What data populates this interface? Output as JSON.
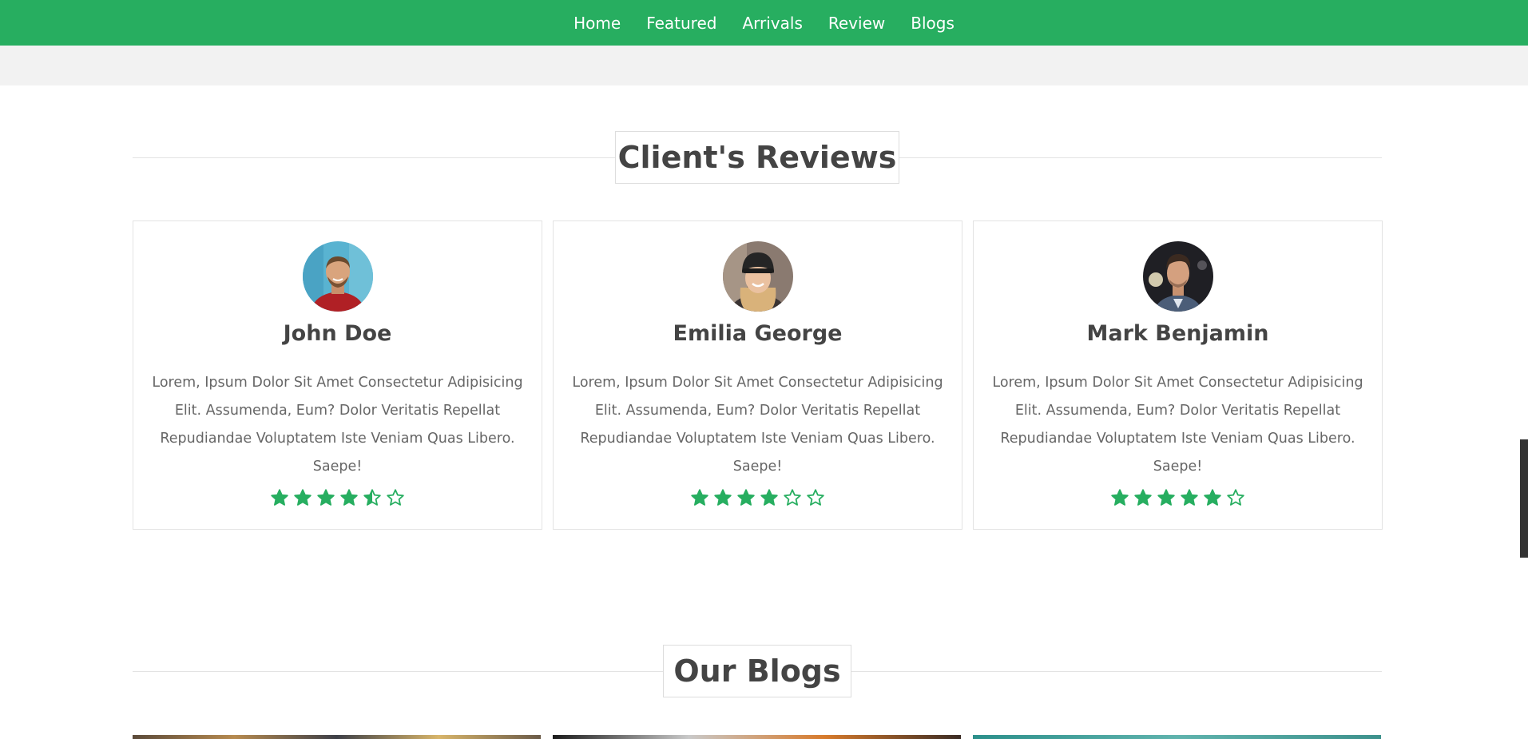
{
  "nav": {
    "items": [
      {
        "label": "Home"
      },
      {
        "label": "Featured"
      },
      {
        "label": "Arrivals"
      },
      {
        "label": "Review"
      },
      {
        "label": "Blogs"
      }
    ]
  },
  "reviews": {
    "heading": "Client's Reviews",
    "cards": [
      {
        "name": "John Doe",
        "text": "Lorem, Ipsum Dolor Sit Amet Consectetur Adipisicing Elit. Assumenda, Eum? Dolor Veritatis Repellat Repudiandae Voluptatem Iste Veniam Quas Libero. Saepe!",
        "rating": 4.5
      },
      {
        "name": "Emilia George",
        "text": "Lorem, Ipsum Dolor Sit Amet Consectetur Adipisicing Elit. Assumenda, Eum? Dolor Veritatis Repellat Repudiandae Voluptatem Iste Veniam Quas Libero. Saepe!",
        "rating": 4
      },
      {
        "name": "Mark Benjamin",
        "text": "Lorem, Ipsum Dolor Sit Amet Consectetur Adipisicing Elit. Assumenda, Eum? Dolor Veritatis Repellat Repudiandae Voluptatem Iste Veniam Quas Libero. Saepe!",
        "rating": 5
      }
    ]
  },
  "blogs": {
    "heading": "Our Blogs"
  },
  "colors": {
    "accent": "#27ae60",
    "heading_text": "#444444",
    "body_text": "#666666"
  }
}
